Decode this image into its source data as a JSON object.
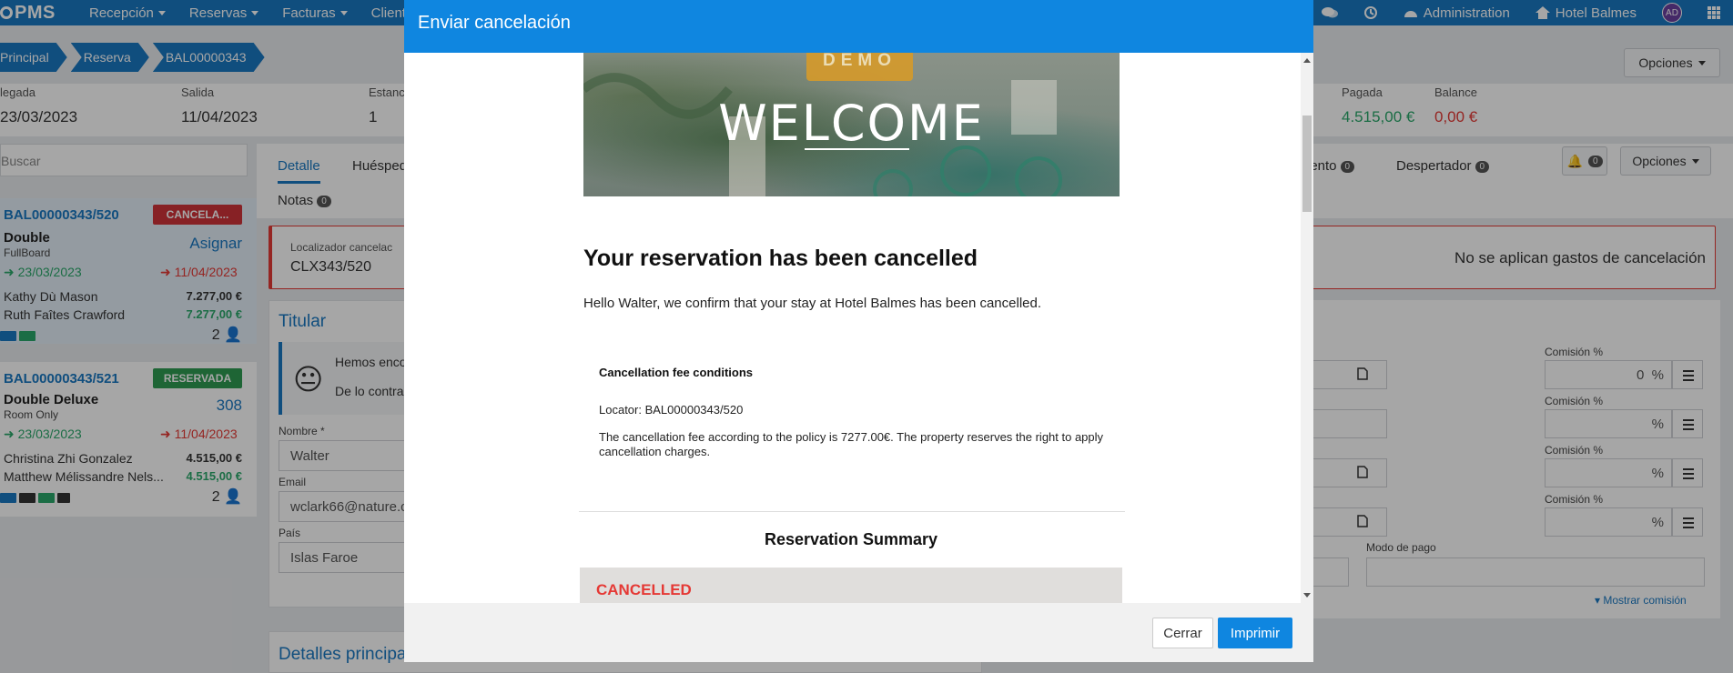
{
  "topnav": {
    "logo": "PMS",
    "menus": [
      "Recepción",
      "Reservas",
      "Facturas",
      "Cliente"
    ],
    "administration": "Administration",
    "hotel": "Hotel Balmes",
    "avatar": "AD"
  },
  "breadcrumb": [
    "Principal",
    "Reserva",
    "BAL00000343"
  ],
  "header_options": "Opciones",
  "stats": [
    {
      "label": "legada",
      "value": "23/03/2023"
    },
    {
      "label": "Salida",
      "value": "11/04/2023"
    },
    {
      "label": "Estanc",
      "value": "1"
    },
    {
      "label": "Pagada",
      "value": "4.515,00 €"
    },
    {
      "label": "Balance",
      "value": "0,00 €"
    }
  ],
  "search_placeholder": "Buscar",
  "reservations": [
    {
      "id": "BAL00000343/520",
      "status": "CANCELA...",
      "room_type": "Double",
      "board": "FullBoard",
      "room": "Asignar",
      "arrival": "23/03/2023",
      "departure": "11/04/2023",
      "guests": [
        {
          "name": "Kathy Dù Mason",
          "amount": "7.277,00 €"
        },
        {
          "name": "Ruth Faîtes Crawford",
          "amount": "7.277,00 €"
        }
      ],
      "pax": "2"
    },
    {
      "id": "BAL00000343/521",
      "status": "RESERVADA",
      "room_type": "Double Deluxe",
      "board": "Room Only",
      "room": "308",
      "arrival": "23/03/2023",
      "departure": "11/04/2023",
      "guests": [
        {
          "name": "Christina Zhi Gonzalez",
          "amount": "4.515,00 €"
        },
        {
          "name": "Matthew Mélissandre Nels...",
          "amount": "4.515,00 €"
        }
      ],
      "pax": "2"
    }
  ],
  "tabs": {
    "detalle": "Detalle",
    "huespedes": "Huésped",
    "notas": "Notas",
    "notas_count": "0",
    "alojamiento": "iento",
    "alojamiento_count": "0",
    "despertador": "Despertador",
    "despertador_count": "0",
    "bell_count": "0",
    "options": "Opciones"
  },
  "cancel_info": {
    "label": "Localizador cancelac",
    "value": "CLX343/520",
    "no_fees": "No se aplican gastos de cancelación"
  },
  "titular": {
    "title": "Titular",
    "notice_line1": "Hemos enco",
    "notice_line2": "De lo contra",
    "name_label": "Nombre *",
    "name": "Walter",
    "email_label": "Email",
    "email": "wclark66@nature.c",
    "country_label": "País",
    "country": "Islas Faroe"
  },
  "details_title": "Detalles principa",
  "commission": {
    "label": "Comisión %",
    "first_value": "0",
    "percent": "%",
    "payment_label": "Modo de pago",
    "show_commission": "Mostrar comisión"
  },
  "modal": {
    "title": "Enviar cancelación",
    "demo": "DEMO",
    "welcome": "WELCOME",
    "heading": "Your reservation has been cancelled",
    "greeting": "Hello Walter, we confirm that your stay at Hotel Balmes has been cancelled.",
    "fee_title": "Cancellation fee conditions",
    "locator": "Locator: BAL00000343/520",
    "policy": "The cancellation fee according to the policy is 7277.00€. The property reserves the right to apply cancellation charges.",
    "summary_title": "Reservation Summary",
    "cancelled": "CANCELLED",
    "close": "Cerrar",
    "print": "Imprimir"
  },
  "colors": {
    "primary": "#1a78c2",
    "modal_header": "#0f86e0",
    "danger": "#e53935",
    "success": "#2aa86a",
    "demo_badge": "#d49a2c"
  }
}
